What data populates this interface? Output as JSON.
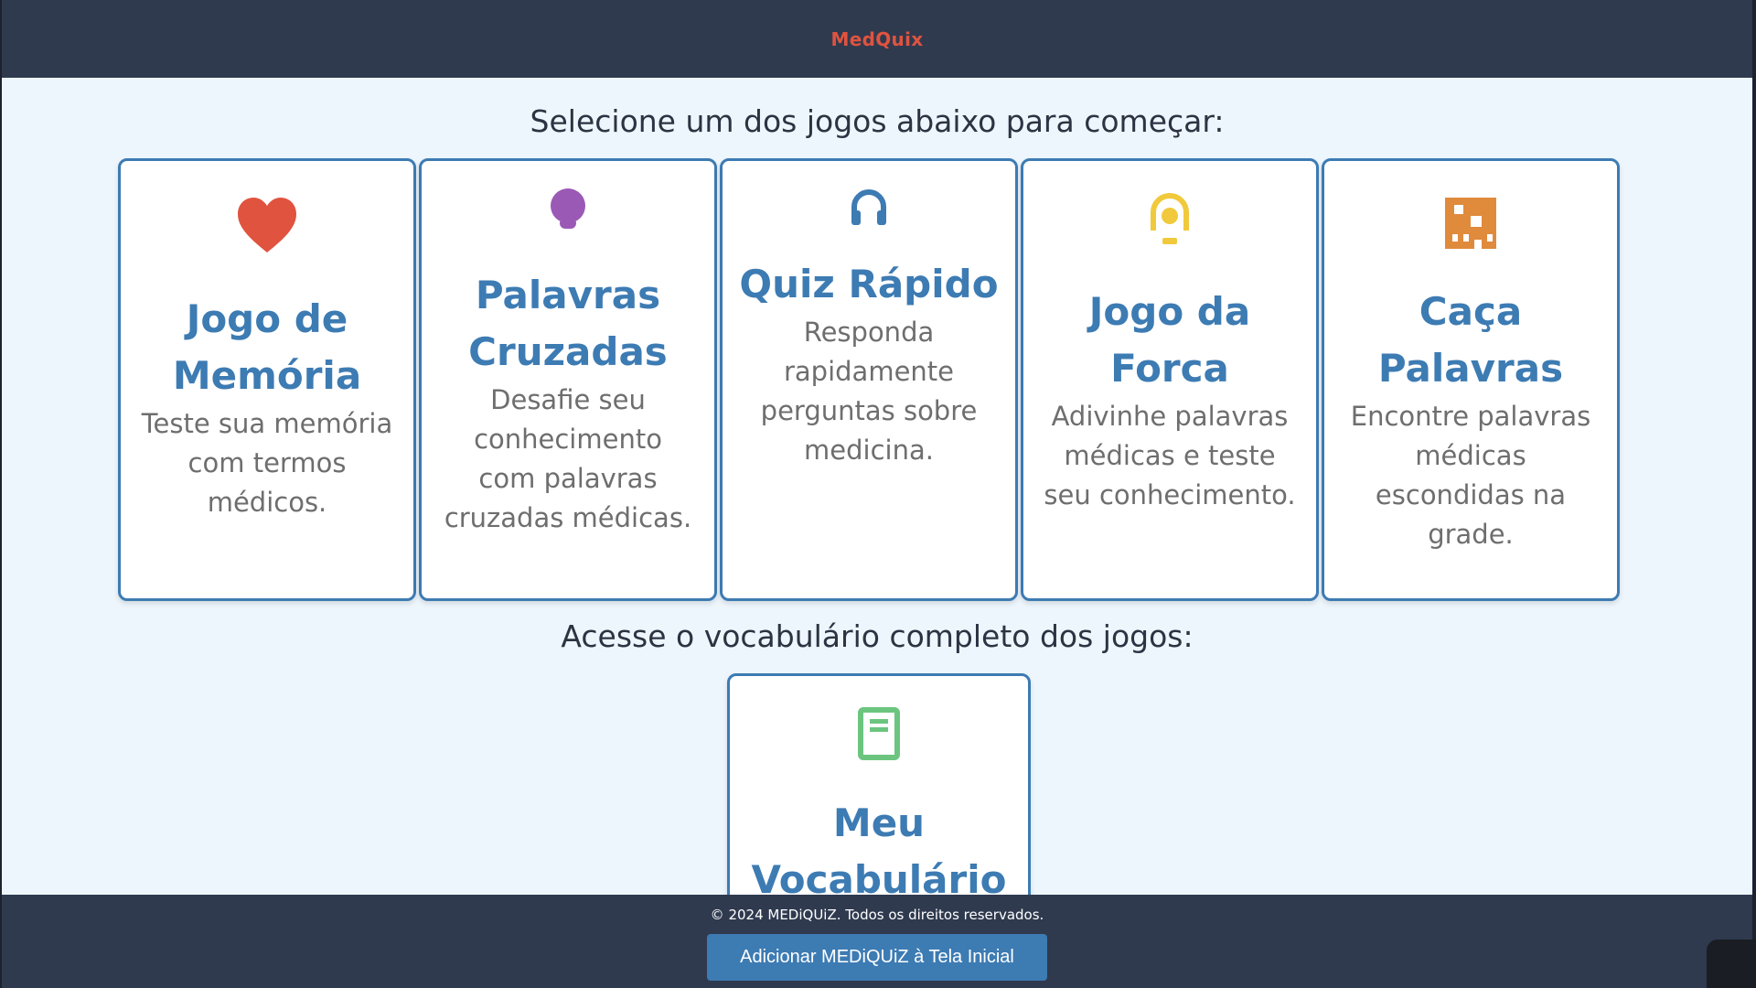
{
  "header": {
    "brand": "MedQuix"
  },
  "main": {
    "prompt_games": "Selecione um dos jogos abaixo para começar:",
    "games": [
      {
        "title": "Jogo de Memória",
        "description": "Teste sua memória com termos médicos.",
        "icon": "heart-icon",
        "color": "#e0533f"
      },
      {
        "title": "Palavras Cruzadas",
        "description": "Desafie seu conhecimento com palavras cruzadas médicas.",
        "icon": "bulb-icon",
        "color": "#9b59b6"
      },
      {
        "title": "Quiz Rápido",
        "description": "Responda rapidamente perguntas sobre medicina.",
        "icon": "headphones-icon",
        "color": "#3d7bb3"
      },
      {
        "title": "Jogo da Forca",
        "description": "Adivinhe palavras médicas e teste seu conhecimento.",
        "icon": "location-pin-icon",
        "color": "#f1c93c"
      },
      {
        "title": "Caça Palavras",
        "description": "Encontre palavras médicas escondidas na grade.",
        "icon": "grid-icon",
        "color": "#e08a3c"
      }
    ],
    "prompt_vocab": "Acesse o vocabulário completo dos jogos:",
    "vocab": {
      "title": "Meu Vocabulário",
      "icon": "book-icon",
      "color": "#6cc57f"
    }
  },
  "footer": {
    "copyright": "© 2024 MEDiQUiZ. Todos os direitos reservados.",
    "install_label": "Adicionar MEDiQUiZ à Tela Inicial"
  }
}
